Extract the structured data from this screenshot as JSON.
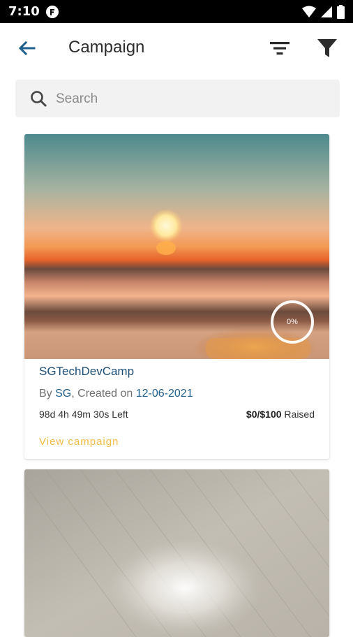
{
  "status_bar": {
    "time": "7:10",
    "notification_icon": "cloud-app-icon",
    "icons": [
      "wifi-icon",
      "signal-icon",
      "battery-icon"
    ]
  },
  "app_bar": {
    "title": "Campaign",
    "back_icon": "arrow-left-icon",
    "sort_icon": "sort-lines-icon",
    "filter_icon": "funnel-icon"
  },
  "search": {
    "placeholder": "Search",
    "value": ""
  },
  "campaigns": [
    {
      "title": "SGTechDevCamp",
      "by_prefix": "By ",
      "author": "SG",
      "created_prefix": ", Created on ",
      "created_date": "12-06-2021",
      "time_left": "98d 4h 49m 30s Left",
      "raised_amount": "$0/$100",
      "raised_label": " Raised",
      "progress": 0,
      "progress_label": "0%",
      "view_label": "View campaign",
      "image": "sunset-beach-photo"
    },
    {
      "image": "wood-texture-photo"
    }
  ],
  "colors": {
    "accent_blue": "#1f5f8b",
    "title_blue": "#1c4e74",
    "view_link": "#f4b942",
    "search_bg": "#f2f2f2"
  }
}
